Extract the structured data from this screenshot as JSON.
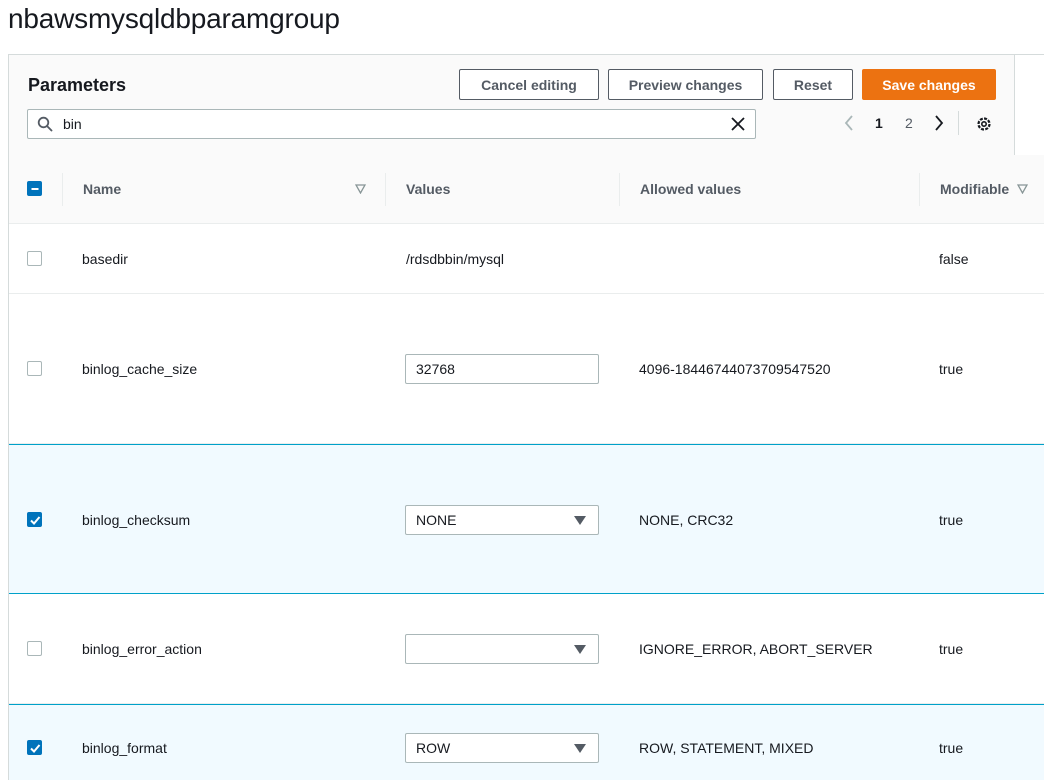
{
  "page": {
    "title": "nbawsmysqldbparamgroup"
  },
  "panel": {
    "title": "Parameters",
    "buttons": {
      "cancel": "Cancel editing",
      "preview": "Preview changes",
      "reset": "Reset",
      "save": "Save changes"
    },
    "search": {
      "value": "bin",
      "icon": "search-icon",
      "clear_icon": "close-icon"
    },
    "pagination": {
      "pages": [
        "1",
        "2"
      ],
      "current": "1"
    },
    "colors": {
      "accent": "#ec7211",
      "selected_bg": "#f1faff",
      "selected_border": "#00a1c9",
      "checkbox": "#0073bb"
    }
  },
  "table": {
    "columns": {
      "name": "Name",
      "values": "Values",
      "allowed": "Allowed values",
      "modifiable": "Modifiable"
    },
    "rows": [
      {
        "name": "basedir",
        "value": "/rdsdbbin/mysql",
        "control": "text",
        "allowed": "",
        "modifiable": "false",
        "selected": false
      },
      {
        "name": "binlog_cache_size",
        "value": "32768",
        "control": "input",
        "allowed": "4096-18446744073709547520",
        "modifiable": "true",
        "selected": false
      },
      {
        "name": "binlog_checksum",
        "value": "NONE",
        "control": "select",
        "allowed": "NONE, CRC32",
        "modifiable": "true",
        "selected": true
      },
      {
        "name": "binlog_error_action",
        "value": "",
        "control": "select",
        "allowed": "IGNORE_ERROR, ABORT_SERVER",
        "modifiable": "true",
        "selected": false
      },
      {
        "name": "binlog_format",
        "value": "ROW",
        "control": "select",
        "allowed": "ROW, STATEMENT, MIXED",
        "modifiable": "true",
        "selected": true
      }
    ]
  }
}
